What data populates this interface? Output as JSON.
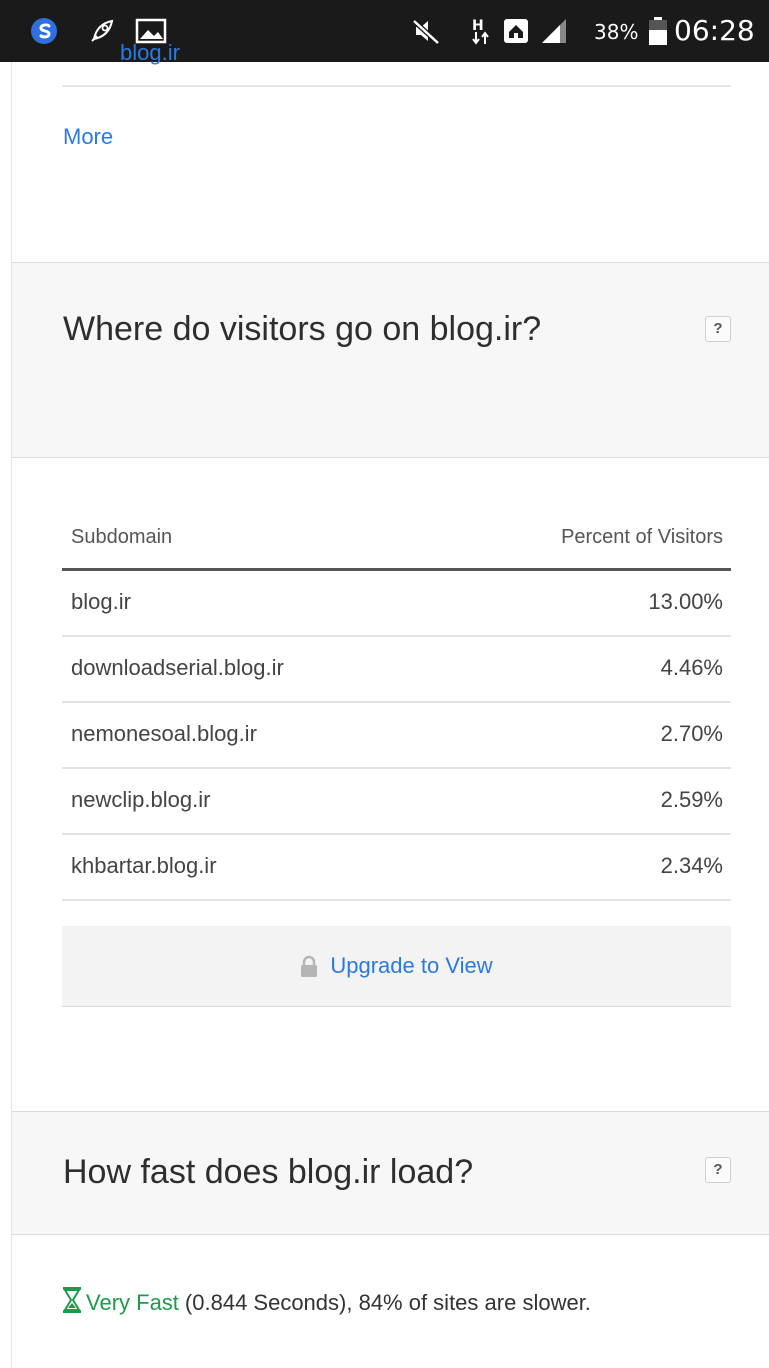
{
  "status_bar": {
    "battery_percent": "38%",
    "time": "06:28",
    "icons": [
      "s-browser-icon",
      "rocket-icon",
      "image-icon",
      "mute-icon",
      "data-transfer-icon",
      "home-icon",
      "signal-icon",
      "battery-icon"
    ]
  },
  "prev_section": {
    "partial_link": "blog.ir",
    "more_label": "More"
  },
  "subdomain_section": {
    "title": "Where do visitors go on blog.ir?",
    "help": "?",
    "columns": [
      "Subdomain",
      "Percent of Visitors"
    ],
    "rows": [
      {
        "subdomain": "blog.ir",
        "percent": "13.00%"
      },
      {
        "subdomain": "downloadserial.blog.ir",
        "percent": "4.46%"
      },
      {
        "subdomain": "nemonesoal.blog.ir",
        "percent": "2.70%"
      },
      {
        "subdomain": "newclip.blog.ir",
        "percent": "2.59%"
      },
      {
        "subdomain": "khbartar.blog.ir",
        "percent": "2.34%"
      }
    ],
    "upgrade_label": "Upgrade to View"
  },
  "speed_section": {
    "title": "How fast does blog.ir load?",
    "help": "?",
    "speed_label": "Very Fast",
    "speed_detail": "(0.844 Seconds), 84% of sites are slower."
  },
  "colors": {
    "link": "#2a7ae2",
    "fast": "#1d9b4b",
    "header_bg": "#f7f7f7"
  }
}
